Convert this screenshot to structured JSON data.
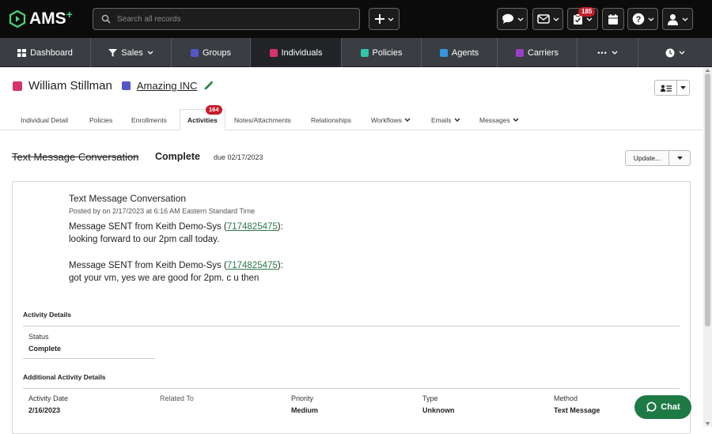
{
  "app": {
    "logo_text": "AMS",
    "logo_plus": "+"
  },
  "search": {
    "placeholder": "Search all records"
  },
  "topbar": {
    "tasks_badge": "185",
    "icons": [
      "plus-icon",
      "chat-bubble-icon",
      "mail-icon",
      "clipboard-check-icon",
      "calendar-icon",
      "help-icon",
      "user-icon"
    ]
  },
  "nav": {
    "items": [
      {
        "label": "Dashboard",
        "icon": "dashboard-icon"
      },
      {
        "label": "Sales",
        "icon": "funnel-icon"
      },
      {
        "label": "Groups",
        "color": "#5356c9"
      },
      {
        "label": "Individuals",
        "color": "#d6336c"
      },
      {
        "label": "Policies",
        "color": "#2fc5a7"
      },
      {
        "label": "Agents",
        "color": "#3497e0"
      },
      {
        "label": "Carriers",
        "color": "#9b3ec6"
      },
      {
        "label": "•••",
        "icon": "more-icon"
      },
      {
        "label": "",
        "icon": "history-clock-icon"
      }
    ]
  },
  "record": {
    "name": "William Stillman",
    "name_color": "#d6336c",
    "company": "Amazing INC",
    "company_color": "#5356c9"
  },
  "tabs": {
    "items": [
      "Individual Detail",
      "Policies",
      "Enrollments",
      "Activities",
      "Notes/Attachments",
      "Relationships",
      "Workflows",
      "Emails",
      "Messages"
    ],
    "activities_badge": "164"
  },
  "activity": {
    "title": "Text Message Conversation",
    "status": "Complete",
    "due": "due 02/17/2023",
    "update_label": "Update..."
  },
  "conversation": {
    "title": "Text Message Conversation",
    "posted": "Posted by on 2/17/2023 at 6:16 AM Eastern Standard Time",
    "messages": [
      {
        "prefix": "Message SENT from Keith Demo-Sys (",
        "phone": "7174825475",
        "suffix": "):",
        "body": "looking forward to our 2pm call today."
      },
      {
        "prefix": "Message SENT from Keith Demo-Sys (",
        "phone": "7174825475",
        "suffix": "):",
        "body": "got your vm, yes we are good for 2pm. c u then"
      }
    ]
  },
  "details": {
    "section_title": "Activity Details",
    "status_label": "Status",
    "status_value": "Complete",
    "additional_title": "Additional Activity Details",
    "columns": [
      {
        "label": "Activity Date",
        "value": "2/16/2023"
      },
      {
        "label": "Related To",
        "value": ""
      },
      {
        "label": "Priority",
        "value": "Medium"
      },
      {
        "label": "Type",
        "value": "Unknown"
      },
      {
        "label": "Method",
        "value": "Text Message"
      }
    ]
  },
  "chat": {
    "label": "Chat"
  },
  "colors": {
    "accent_green": "#1e7a45",
    "badge_red": "#c41e2c",
    "nav_bg": "#3a3d42"
  }
}
